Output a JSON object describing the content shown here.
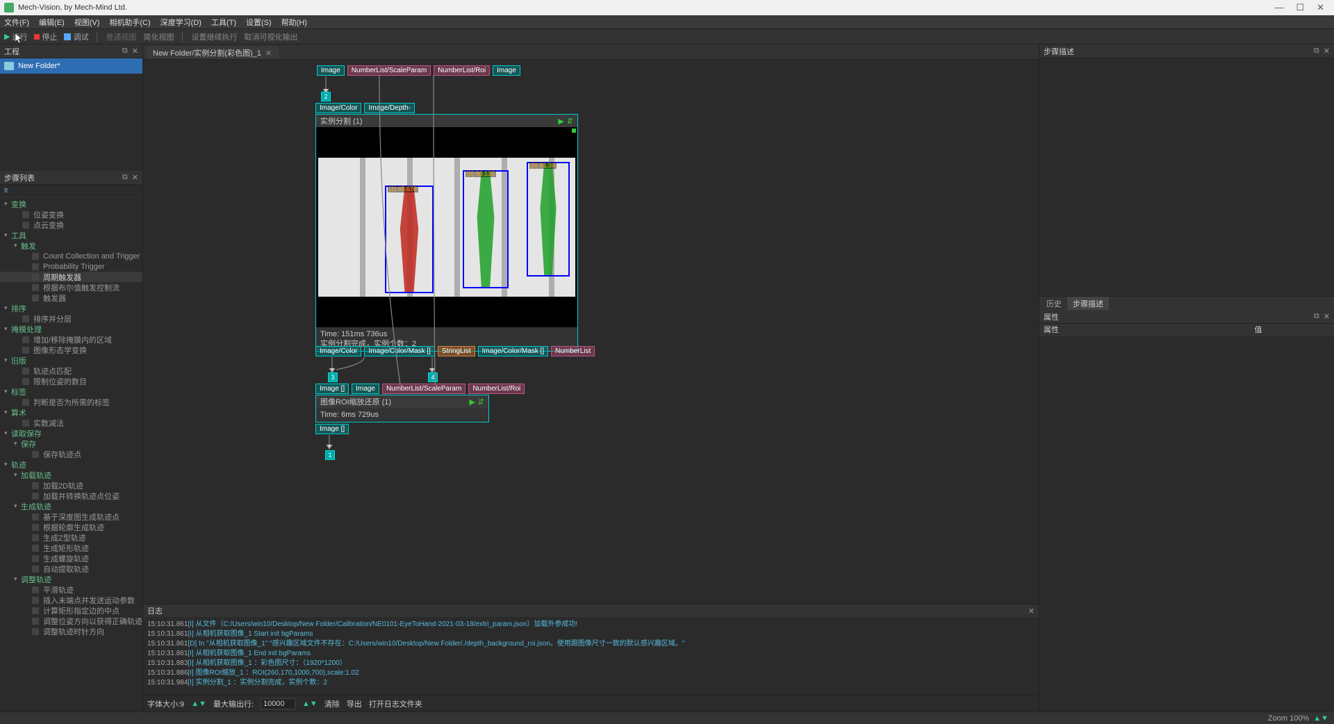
{
  "title": "Mech-Vision, by Mech-Mind Ltd.",
  "menu": [
    "文件(F)",
    "编辑(E)",
    "视图(V)",
    "相机助手(C)",
    "深度学习(D)",
    "工具(T)",
    "设置(S)",
    "帮助(H)"
  ],
  "toolbar": {
    "run": "运行",
    "stop": "停止",
    "debug": "调试",
    "normalView": "普通视图",
    "simpleView": "简化视图",
    "continueExec": "设置继续执行",
    "cancelVis": "取消可视化输出"
  },
  "proj_panel_title": "工程",
  "project_item": "New Folder*",
  "steplist_title": "步骤列表",
  "step_filter": "tr",
  "tree": [
    {
      "t": "cat",
      "arrow": "▾",
      "label": "变换"
    },
    {
      "t": "leaf",
      "label": "位姿变换"
    },
    {
      "t": "leaf",
      "label": "点云变换"
    },
    {
      "t": "cat",
      "arrow": "▾",
      "label": "工具"
    },
    {
      "t": "subcat",
      "arrow": "▾",
      "label": "触发"
    },
    {
      "t": "leafs",
      "label": "Count Collection and Trigger"
    },
    {
      "t": "leafs",
      "label": "Probability Trigger"
    },
    {
      "t": "leafs",
      "label": "周期触发器",
      "hl": true
    },
    {
      "t": "leafs",
      "label": "根据布尔值触发控制流"
    },
    {
      "t": "leafs",
      "label": "触发器"
    },
    {
      "t": "cat",
      "arrow": "▾",
      "label": "排序"
    },
    {
      "t": "leaf",
      "label": "排序并分层"
    },
    {
      "t": "cat",
      "arrow": "▾",
      "label": "掩模处理"
    },
    {
      "t": "leaf",
      "label": "增加/移除掩膜内的区域"
    },
    {
      "t": "leaf",
      "label": "图像形态学变换"
    },
    {
      "t": "cat",
      "arrow": "▾",
      "label": "旧版"
    },
    {
      "t": "leaf",
      "label": "轨迹点匹配"
    },
    {
      "t": "leaf",
      "label": "限制位姿的数目"
    },
    {
      "t": "cat",
      "arrow": "▾",
      "label": "标签"
    },
    {
      "t": "leaf",
      "label": "判断是否为所需的标签"
    },
    {
      "t": "cat",
      "arrow": "▾",
      "label": "算术"
    },
    {
      "t": "leaf",
      "label": "实数减法"
    },
    {
      "t": "cat",
      "arrow": "▾",
      "label": "读取保存"
    },
    {
      "t": "subcat",
      "arrow": "▾",
      "label": "保存"
    },
    {
      "t": "leafs",
      "label": "保存轨迹点"
    },
    {
      "t": "cat",
      "arrow": "▾",
      "label": "轨迹"
    },
    {
      "t": "subcat",
      "arrow": "▾",
      "label": "加载轨迹"
    },
    {
      "t": "leafs",
      "label": "加载2D轨迹"
    },
    {
      "t": "leafs",
      "label": "加载并转换轨迹点位姿"
    },
    {
      "t": "subcat",
      "arrow": "▾",
      "label": "生成轨迹"
    },
    {
      "t": "leafs",
      "label": "基于深度图生成轨迹点"
    },
    {
      "t": "leafs",
      "label": "根据轮廓生成轨迹"
    },
    {
      "t": "leafs",
      "label": "生成Z型轨迹"
    },
    {
      "t": "leafs",
      "label": "生成矩形轨迹"
    },
    {
      "t": "leafs",
      "label": "生成螺旋轨迹"
    },
    {
      "t": "leafs",
      "label": "自动提取轨迹"
    },
    {
      "t": "subcat",
      "arrow": "▾",
      "label": "调整轨迹"
    },
    {
      "t": "leafs",
      "label": "平滑轨迹"
    },
    {
      "t": "leafs",
      "label": "插入未端点并发送运动参数"
    },
    {
      "t": "leafs",
      "label": "计算矩形指定边的中点"
    },
    {
      "t": "leafs",
      "label": "调整位姿方向以获得正确轨迹"
    },
    {
      "t": "leafs",
      "label": "调整轨迹时针方向"
    }
  ],
  "canvas_tab": "New Folder/实例分割(彩色图)_1",
  "canvas": {
    "top_ports": [
      "Image",
      "NumberList/ScaleParam",
      "NumberList/Roi",
      "Image"
    ],
    "num_top": "2",
    "depth_ports": [
      "Image/Color",
      "Image/Depth-"
    ],
    "big1_title": "实例分割 (1)",
    "big1_time": "Time: 151ms 736us",
    "big1_result": "实例分割完成，实例个数：2",
    "big1_out": [
      "Image/Color",
      "Image/Color/Mask []",
      "StringList",
      "Image/Color/Mask []",
      "NumberList"
    ],
    "mid_nums": {
      "a": "3",
      "b": "4"
    },
    "big2_in": [
      "Image []",
      "Image",
      "NumberList/ScaleParam",
      "NumberList/Roi"
    ],
    "big2_title": "图像ROI缩放还原 (1)",
    "big2_time": "Time: 6ms 729us",
    "big2_out": [
      "Image []"
    ],
    "bottom_num": "1",
    "seg_labels": [
      "[1] 45.670",
      "[0] 90.132",
      "[0] 81.34"
    ]
  },
  "log_title": "日志",
  "logs": [
    {
      "ts": "15:10:31.861",
      "lvl": "[I]",
      "msg": " 从文件（C:/Users/win10/Desktop/New Folder/Calibration/NE0101-EyeToHand-2021-03-18/extri_param.json）加载外参成功!"
    },
    {
      "ts": "15:10:31.861",
      "lvl": "[I]",
      "msg": " 从相机获取图像_1 Start init bgParams"
    },
    {
      "ts": "15:10:31.861",
      "lvl": "[D]",
      "msg": " In \"从相机获取图像_1\" \"感兴趣区域文件不存在：C:/Users/win10/Desktop/New Folder/./depth_background_roi.json，使用跟图像尺寸一致的默认感兴趣区域。\""
    },
    {
      "ts": "15:10:31.861",
      "lvl": "[I]",
      "msg": " 从相机获取图像_1 End init bgParams"
    },
    {
      "ts": "15:10:31.883",
      "lvl": "[I]",
      "msg": " 从相机获取图像_1 ：彩色图尺寸：（1920*1200）"
    },
    {
      "ts": "15:10:31.886",
      "lvl": "[I]",
      "msg": " 图像ROI缩放_1 ：ROI(260,170,1000,700),scale:1.02"
    },
    {
      "ts": "15:10:31.984",
      "lvl": "[I]",
      "msg": " 实例分割_1 ：实例分割完成，实例个数：2"
    }
  ],
  "log_bar": {
    "font": "字体大小:9",
    "maxout": "最大输出行:",
    "maxout_val": "10000",
    "clear": "清除",
    "export": "导出",
    "openfolder": "打开日志文件夹"
  },
  "right": {
    "desc_title": "步骤描述",
    "history_tabs": [
      "历史",
      "步骤描述"
    ],
    "props_title": "属性",
    "props_cols": [
      "属性",
      "值"
    ]
  },
  "status_zoom": "Zoom 100%"
}
